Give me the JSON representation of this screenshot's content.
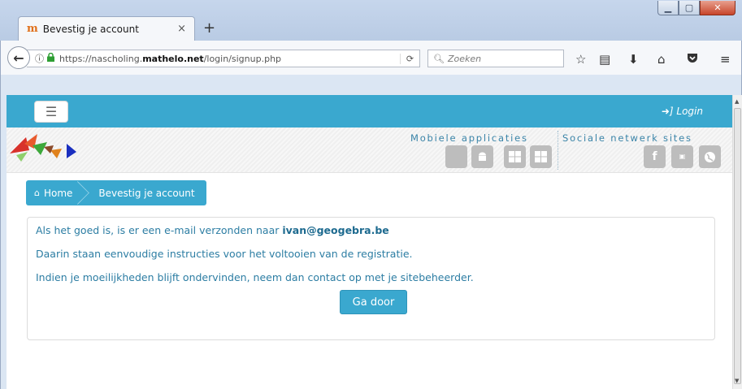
{
  "browser": {
    "tab_title": "Bevestig je account",
    "tab_favicon": "m",
    "new_tab_label": "+",
    "tab_close": "×",
    "url_prefix": "https://nascholing.",
    "url_domain": "mathelo.net",
    "url_path": "/login/signup.php",
    "search_placeholder": "Zoeken",
    "window_buttons": {
      "minimize": "▁",
      "maximize": "▢",
      "close": "✕"
    }
  },
  "site": {
    "accent_color": "#3aa8cf",
    "login_label": "Login",
    "mobile_apps_title": "Mobiele applicaties",
    "social_title": "Sociale netwerk sites",
    "mobile_icons": [
      "apple-icon",
      "android-icon",
      "windows-icon",
      "windows-phone-icon"
    ],
    "social_icons": [
      "facebook-icon",
      "youtube-icon",
      "globe-icon"
    ],
    "breadcrumb": {
      "home": "Home",
      "current": "Bevestig je account"
    }
  },
  "message": {
    "line1_prefix": "Als het goed is, is er een e-mail verzonden naar ",
    "email": "ivan@geogebra.be",
    "line2": "Daarin staan eenvoudige instructies voor het voltooien van de registratie.",
    "line3": "Indien je moeilijkheden blijft ondervinden, neem dan contact op met je sitebeheerder.",
    "continue_button": "Ga door"
  }
}
